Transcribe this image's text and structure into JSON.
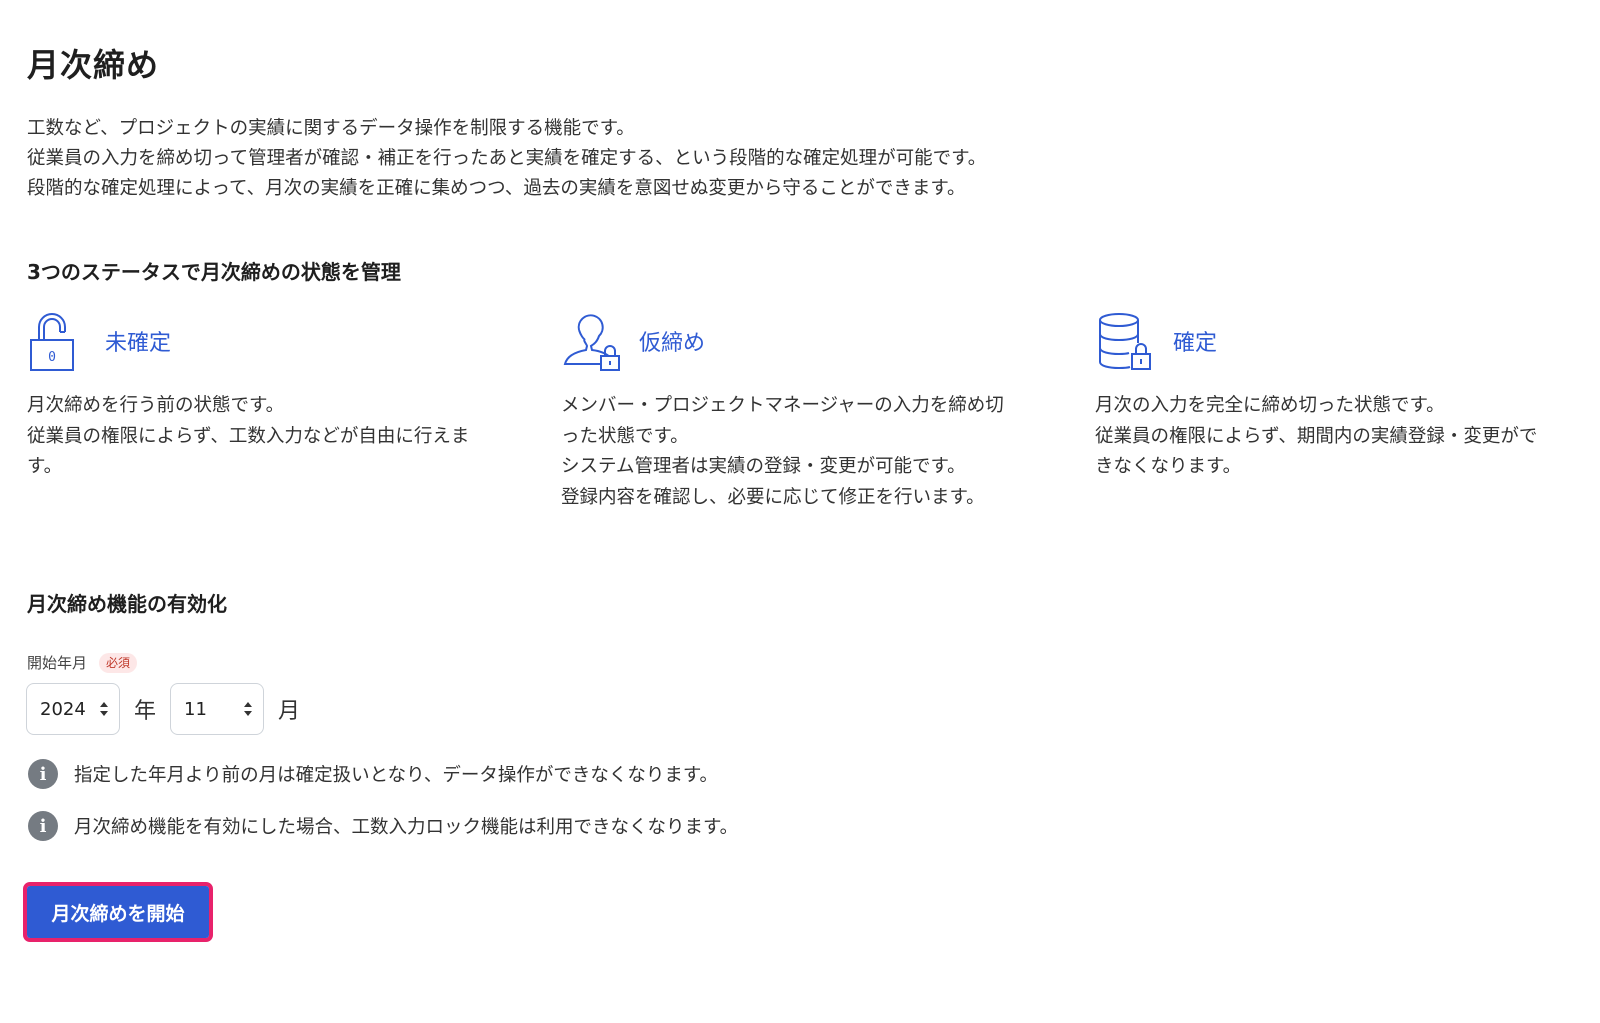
{
  "page": {
    "title": "月次締め",
    "intro": [
      "工数など、プロジェクトの実績に関するデータ操作を制限する機能です。",
      "従業員の入力を締め切って管理者が確認・補正を行ったあと実績を確定する、という段階的な確定処理が可能です。",
      "段階的な確定処理によって、月次の実績を正確に集めつつ、過去の実績を意図せぬ変更から守ることができます。"
    ]
  },
  "statuses": {
    "heading": "3つのステータスで月次締めの状態を管理",
    "items": [
      {
        "name": "未確定",
        "icon": "unlocked-padlock-icon",
        "lines": [
          "月次締めを行う前の状態です。",
          "従業員の権限によらず、工数入力などが自由に行えま",
          "す。"
        ]
      },
      {
        "name": "仮締め",
        "icon": "user-lock-icon",
        "lines": [
          "メンバー・プロジェクトマネージャーの入力を締め切",
          "った状態です。",
          "システム管理者は実績の登録・変更が可能です。",
          "登録内容を確認し、必要に応じて修正を行います。"
        ]
      },
      {
        "name": "確定",
        "icon": "database-lock-icon",
        "lines": [
          "月次の入力を完全に締め切った状態です。",
          "従業員の権限によらず、期間内の実績登録・変更がで",
          "きなくなります。"
        ]
      }
    ]
  },
  "enable": {
    "heading": "月次締め機能の有効化",
    "field_label": "開始年月",
    "required_badge": "必須",
    "year_value": "2024",
    "year_unit": "年",
    "month_value": "11",
    "month_unit": "月",
    "notes": [
      "指定した年月より前の月は確定扱いとなり、データ操作ができなくなります。",
      "月次締め機能を有効にした場合、工数入力ロック機能は利用できなくなります。"
    ],
    "info_icon": "info-icon",
    "start_button": "月次締めを開始"
  },
  "colors": {
    "accent": "#2f5bd3",
    "highlight_border": "#e8226b",
    "info_icon_bg": "#757b82",
    "required_text": "#c0392b"
  }
}
